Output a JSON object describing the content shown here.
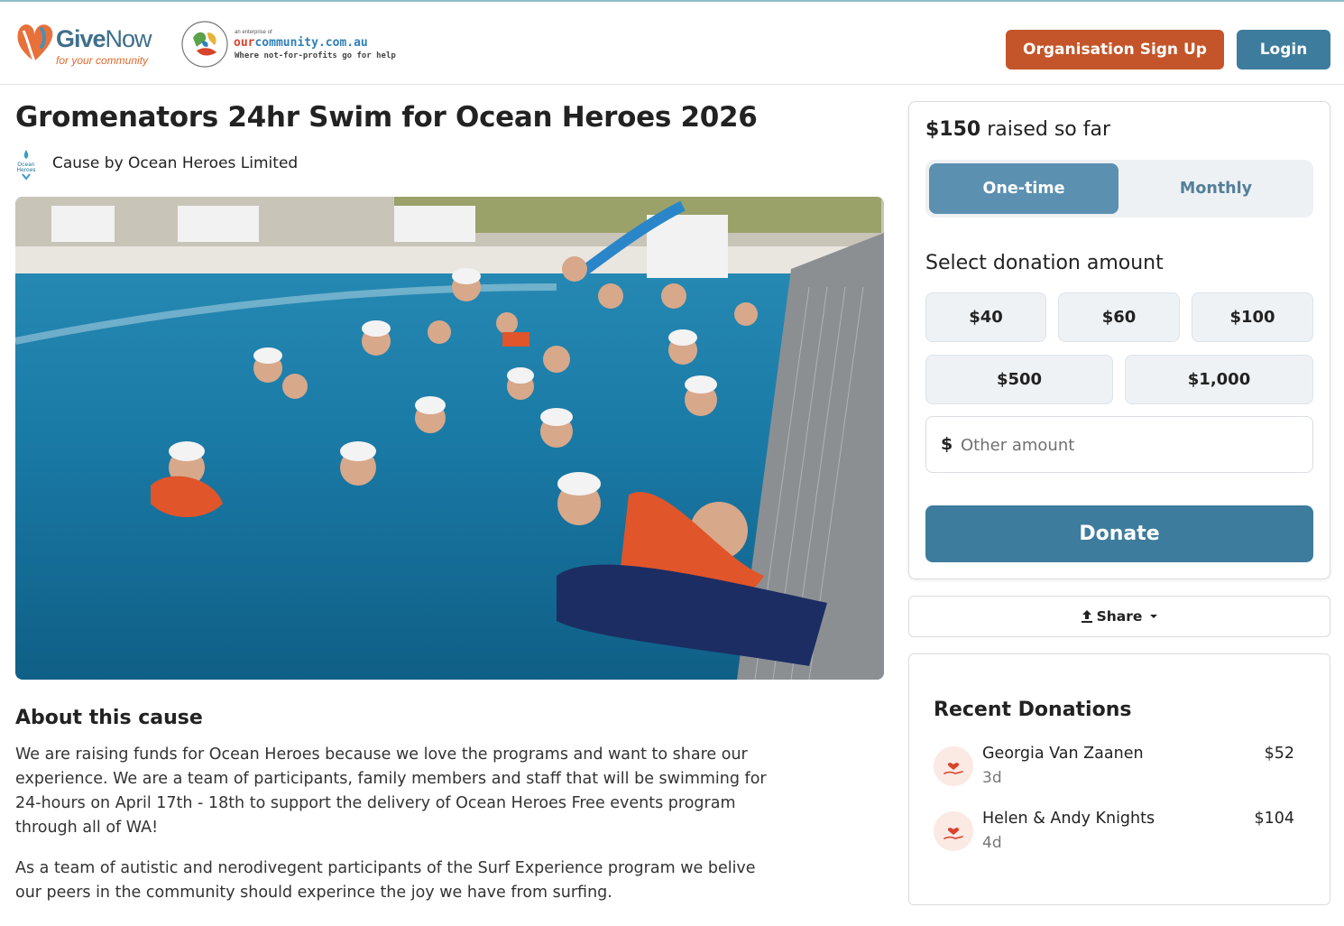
{
  "header": {
    "brand_bold": "Give",
    "brand_light": "Now",
    "brand_tagline": "for your community",
    "partner_pretext": "an enterprise of",
    "partner_name_a": "our",
    "partner_name_b": "community",
    "partner_name_c": ".com.au",
    "partner_tagline": "Where not-for-profits go for help",
    "signup_label": "Organisation Sign Up",
    "login_label": "Login"
  },
  "cause": {
    "title": "Gromenators 24hr Swim for Ocean Heroes 2026",
    "org_logo_text": "Ocean Heroes",
    "byline": "Cause by Ocean Heroes Limited",
    "about_heading": "About this cause",
    "about_p1": "We are raising funds for Ocean Heroes because we love the programs and want to share our experience. We are a team of participants, family members and staff that will be swimming for 24-hours on April 17th - 18th to support the delivery of Ocean Heroes Free events program through all of WA!",
    "about_p2": "As a team of autistic and nerodivegent participants of the Surf Experience program we belive our peers in the community should experince the joy we have from surfing."
  },
  "donate": {
    "raised_amount": "$150",
    "raised_suffix": " raised so far",
    "freq_one_time": "One-time",
    "freq_monthly": "Monthly",
    "select_label": "Select donation amount",
    "amounts": [
      "$40",
      "$60",
      "$100",
      "$500",
      "$1,000"
    ],
    "currency_symbol": "$",
    "other_placeholder": "Other amount",
    "donate_label": "Donate"
  },
  "share": {
    "label": "Share"
  },
  "recent": {
    "heading": "Recent Donations",
    "items": [
      {
        "name": "Georgia Van Zaanen",
        "ago": "3d",
        "amount": "$52"
      },
      {
        "name": "Helen & Andy Knights",
        "ago": "4d",
        "amount": "$104"
      }
    ]
  },
  "colors": {
    "primary": "#3d7c9c",
    "signup": "#c4552a",
    "toggle_active": "#5b90b0",
    "brand_orange": "#e06a2c"
  },
  "icons": {
    "givenow_logo": "heart-hand-logo",
    "partner_logo": "hands-globe-logo",
    "share": "upload-icon",
    "share_caret": "caret-down-icon",
    "donation": "heart-hand-icon"
  }
}
